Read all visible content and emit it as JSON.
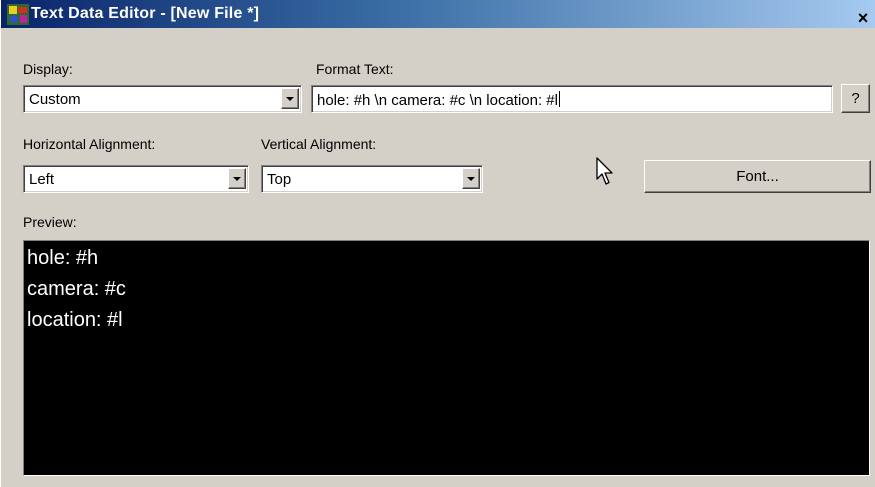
{
  "window": {
    "title": "Text Data Editor - [New File *]",
    "close_glyph": "×",
    "icon": "app-icon"
  },
  "display": {
    "label": "Display:",
    "value": "Custom"
  },
  "format_text": {
    "label": "Format Text:",
    "value": "hole: #h \\n camera:  #c \\n location: #l",
    "help_label": "?"
  },
  "horizontal_alignment": {
    "label": "Horizontal Alignment:",
    "value": "Left"
  },
  "vertical_alignment": {
    "label": "Vertical Alignment:",
    "value": "Top"
  },
  "font_button": {
    "label": "Font..."
  },
  "preview": {
    "label": "Preview:",
    "lines": [
      "hole: #h",
      "camera:  #c",
      "location: #l"
    ],
    "background": "#000000",
    "text_color": "#ffffff"
  },
  "colors": {
    "dialog_face": "#d4d0c8",
    "title_gradient_start": "#0a246a",
    "title_gradient_end": "#a6caf0"
  }
}
